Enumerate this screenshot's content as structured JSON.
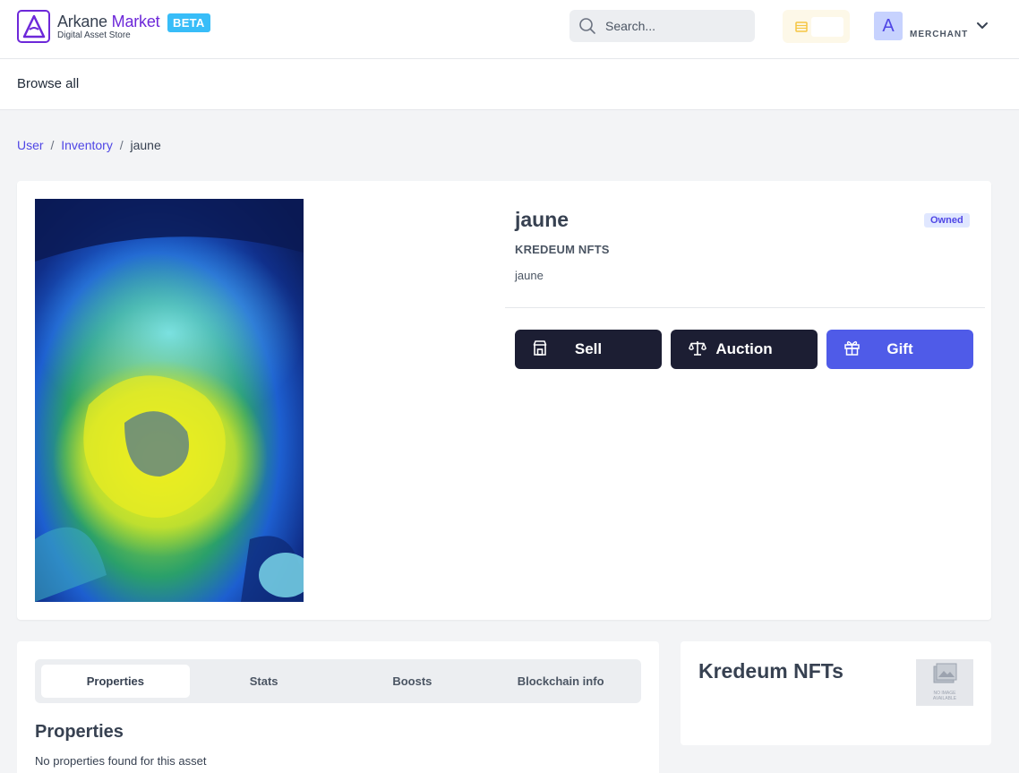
{
  "header": {
    "logo_name_part1": "Arkane",
    "logo_name_part2": "Market",
    "logo_sub": "Digital Asset Store",
    "beta": "BETA",
    "search_placeholder": "Search...",
    "avatar_letter": "A",
    "role": "MERCHANT"
  },
  "nav": {
    "browse_all": "Browse all"
  },
  "breadcrumb": {
    "items": [
      "User",
      "Inventory"
    ],
    "separator": "/",
    "current": "jaune"
  },
  "asset": {
    "title": "jaune",
    "status": "Owned",
    "collection": "KREDEUM NFTS",
    "description": "jaune"
  },
  "actions": {
    "sell": "Sell",
    "auction": "Auction",
    "gift": "Gift"
  },
  "tabs": {
    "items": [
      "Properties",
      "Stats",
      "Boosts",
      "Blockchain info"
    ],
    "active": "Properties"
  },
  "properties": {
    "title": "Properties",
    "empty": "No properties found for this asset"
  },
  "collection_card": {
    "title": "Kredeum NFTs",
    "no_image_line1": "NO IMAGE",
    "no_image_line2": "AVAILABLE"
  },
  "colors": {
    "brand": "#6d28d9",
    "beta": "#38bdf8",
    "dark_button": "#1c1e33",
    "primary_button": "#4f5be8",
    "link": "#4f46e5"
  }
}
